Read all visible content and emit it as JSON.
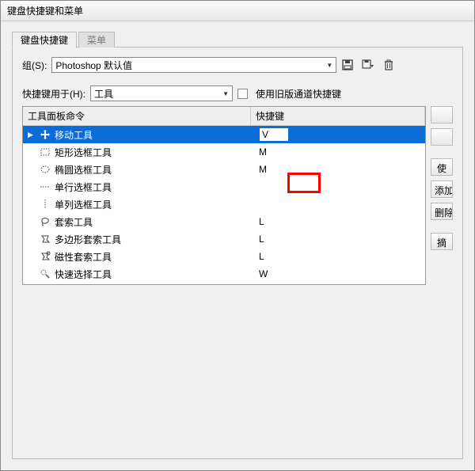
{
  "window": {
    "title": "键盘快捷键和菜单"
  },
  "tabs": [
    {
      "label": "键盘快捷键",
      "active": true
    },
    {
      "label": "菜单",
      "active": false
    }
  ],
  "set": {
    "label": "组(S):",
    "value": "Photoshop 默认值"
  },
  "toolbar_icons": {
    "save": "save-icon",
    "save_as": "save-as-icon",
    "trash": "trash-icon"
  },
  "shortcuts_for": {
    "label": "快捷键用于(H):",
    "value": "工具"
  },
  "legacy": {
    "label": "使用旧版通道快捷键"
  },
  "table": {
    "headers": {
      "command": "工具面板命令",
      "shortcut": "快捷键"
    },
    "rows": [
      {
        "name": "移动工具",
        "shortcut": "V",
        "selected": true,
        "editing": true,
        "icon": "move"
      },
      {
        "name": "矩形选框工具",
        "shortcut": "M",
        "icon": "rect-marquee"
      },
      {
        "name": "椭圆选框工具",
        "shortcut": "M",
        "icon": "ellipse-marquee"
      },
      {
        "name": "单行选框工具",
        "shortcut": "",
        "icon": "row-marquee"
      },
      {
        "name": "单列选框工具",
        "shortcut": "",
        "icon": "col-marquee"
      },
      {
        "name": "套索工具",
        "shortcut": "L",
        "icon": "lasso"
      },
      {
        "name": "多边形套索工具",
        "shortcut": "L",
        "icon": "poly-lasso"
      },
      {
        "name": "磁性套索工具",
        "shortcut": "L",
        "icon": "mag-lasso"
      },
      {
        "name": "快速选择工具",
        "shortcut": "W",
        "icon": "quick-select"
      }
    ]
  },
  "side_buttons": {
    "b1": "",
    "b2": "",
    "b3": "使",
    "b4": "添加",
    "b5": "删除",
    "b6": "摘"
  }
}
